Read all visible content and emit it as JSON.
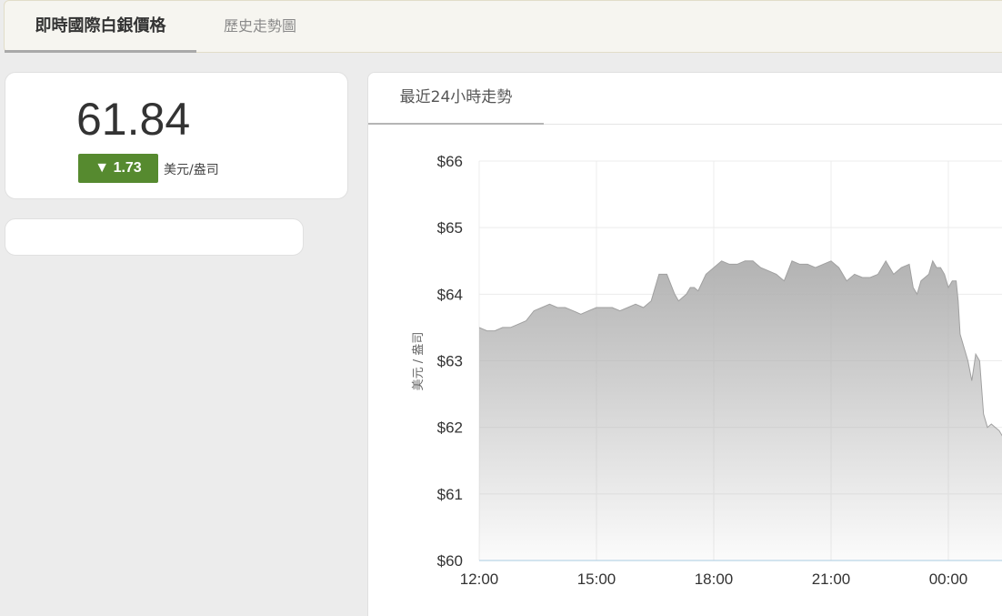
{
  "tabs": {
    "active": "即時國際白銀價格",
    "inactive": "歷史走勢圖"
  },
  "price": {
    "value": "61.84",
    "change": "▼ 1.73",
    "unit": "美元/盎司",
    "change_color": "#568a2f"
  },
  "chart_panel": {
    "tab_label": "最近24小時走勢"
  },
  "chart_data": {
    "type": "area",
    "ylabel": "美元 / 盎司",
    "yticks": [
      "$66",
      "$65",
      "$64",
      "$63",
      "$62",
      "$61",
      "$60"
    ],
    "xticks": [
      "12:00",
      "15:00",
      "18:00",
      "21:00",
      "00:00"
    ],
    "ylim": [
      60,
      66
    ],
    "xlim_hours": [
      0,
      13.5
    ],
    "grid": true,
    "x": [
      0,
      0.2,
      0.4,
      0.6,
      0.8,
      1.0,
      1.2,
      1.4,
      1.6,
      1.8,
      2.0,
      2.2,
      2.4,
      2.6,
      2.8,
      3.0,
      3.2,
      3.4,
      3.6,
      3.8,
      4.0,
      4.2,
      4.4,
      4.6,
      4.8,
      5.0,
      5.1,
      5.2,
      5.3,
      5.4,
      5.5,
      5.6,
      5.8,
      6.0,
      6.2,
      6.4,
      6.6,
      6.8,
      7.0,
      7.2,
      7.4,
      7.6,
      7.8,
      8.0,
      8.2,
      8.4,
      8.6,
      8.8,
      9.0,
      9.2,
      9.4,
      9.6,
      9.8,
      10.0,
      10.2,
      10.4,
      10.6,
      10.8,
      11.0,
      11.1,
      11.2,
      11.3,
      11.4,
      11.5,
      11.6,
      11.7,
      11.8,
      11.9,
      12.0,
      12.1,
      12.2,
      12.25,
      12.3,
      12.4,
      12.5,
      12.6,
      12.7,
      12.8,
      12.9,
      13.0,
      13.1,
      13.2,
      13.3,
      13.4,
      13.5
    ],
    "values": [
      63.5,
      63.45,
      63.45,
      63.5,
      63.5,
      63.55,
      63.6,
      63.75,
      63.8,
      63.85,
      63.8,
      63.8,
      63.75,
      63.7,
      63.75,
      63.8,
      63.8,
      63.8,
      63.75,
      63.8,
      63.85,
      63.8,
      63.9,
      64.3,
      64.3,
      64.0,
      63.9,
      63.95,
      64.0,
      64.1,
      64.1,
      64.05,
      64.3,
      64.4,
      64.5,
      64.45,
      64.45,
      64.5,
      64.5,
      64.4,
      64.35,
      64.3,
      64.2,
      64.5,
      64.45,
      64.45,
      64.4,
      64.45,
      64.5,
      64.4,
      64.2,
      64.3,
      64.25,
      64.25,
      64.3,
      64.5,
      64.3,
      64.4,
      64.45,
      64.1,
      64.0,
      64.2,
      64.25,
      64.3,
      64.5,
      64.4,
      64.4,
      64.3,
      64.1,
      64.2,
      64.2,
      63.9,
      63.4,
      63.2,
      63.0,
      62.7,
      63.1,
      63.0,
      62.2,
      62.0,
      62.05,
      62.0,
      61.95,
      61.85,
      61.84
    ]
  }
}
